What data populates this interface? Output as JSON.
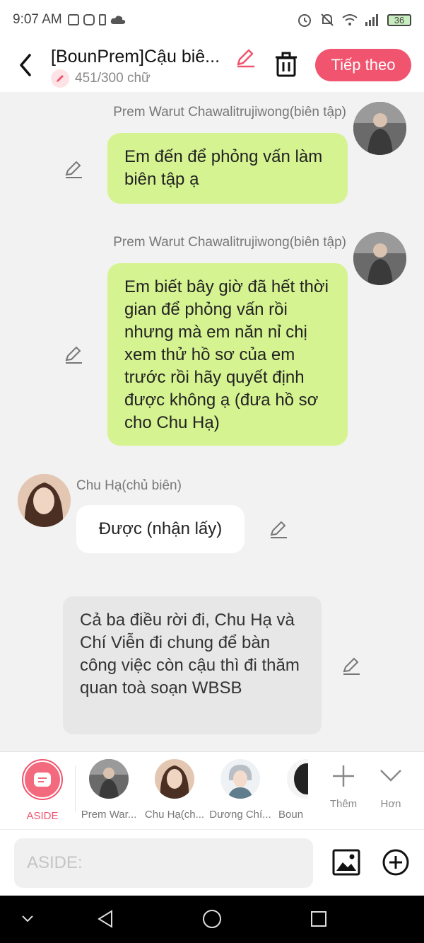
{
  "status": {
    "time": "9:07 AM",
    "battery": "36"
  },
  "header": {
    "title": "[BounPrem]Cậu biê...",
    "word_count": "451/300 chữ",
    "next_label": "Tiếp theo"
  },
  "messages": [
    {
      "sender": "Prem Warut Chawalitrujiwong(biên tập)",
      "text": "Em đến để phỏng vấn làm biên tập ạ"
    },
    {
      "sender": "Prem Warut Chawalitrujiwong(biên tập)",
      "text": "Em biết bây giờ đã hết thời gian để phỏng vấn rồi nhưng mà em năn nỉ chị xem thử hồ sơ của em trước rồi hãy quyết định được không ạ (đưa hồ sơ cho Chu Hạ)"
    },
    {
      "sender": "Chu Hạ(chủ biên)",
      "text": "Được (nhận lấy)"
    },
    {
      "text": "Cả ba điều rời đi, Chu Hạ và Chí Viễn đi chung để bàn công việc còn cậu thì đi thăm quan toà soạn WBSB"
    }
  ],
  "characters": {
    "aside": "ASIDE",
    "items": [
      {
        "name": "Prem War..."
      },
      {
        "name": "Chu Hạ(ch..."
      },
      {
        "name": "Dương Chí..."
      },
      {
        "name": "Boun"
      }
    ],
    "add_label": "Thêm",
    "more_label": "Hơn"
  },
  "input": {
    "placeholder": "ASIDE:"
  },
  "colors": {
    "accent": "#f0546e",
    "right_bubble": "#d6f391",
    "aside_bubble": "#e7e7e7"
  }
}
